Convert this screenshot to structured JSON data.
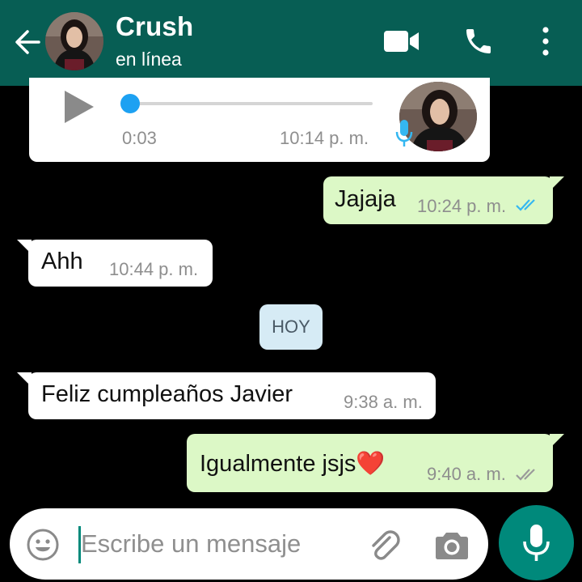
{
  "header": {
    "contact_name": "Crush",
    "status": "en línea",
    "icons": [
      "back-arrow-icon",
      "video-call-icon",
      "phone-icon",
      "more-vert-icon"
    ],
    "background_color": "#075e54"
  },
  "voice_note": {
    "duration": "0:03",
    "time": "10:14 p. m.",
    "progress": 0.0,
    "accent_color": "#1da1f2"
  },
  "messages": [
    {
      "direction": "outgoing",
      "text": "Jajaja",
      "time": "10:24 p. m.",
      "status": "read"
    },
    {
      "direction": "incoming",
      "text": "Ahh",
      "time": "10:44 p. m."
    },
    {
      "direction": "incoming",
      "text": "Feliz cumpleaños Javier",
      "time": "9:38 a. m."
    },
    {
      "direction": "outgoing",
      "text": "Igualmente jsjs❤️",
      "time": "9:40 a. m.",
      "status": "delivered"
    }
  ],
  "date_divider": "HOY",
  "composer": {
    "placeholder": "Escribe un mensaje",
    "icons": [
      "emoji-icon",
      "attach-icon",
      "camera-icon",
      "mic-icon"
    ]
  },
  "colors": {
    "outgoing_bubble": "#dcf8c6",
    "incoming_bubble": "#ffffff",
    "read_ticks": "#34b7f1",
    "delivered_ticks": "#9a9a9a",
    "fab": "#00897b"
  }
}
